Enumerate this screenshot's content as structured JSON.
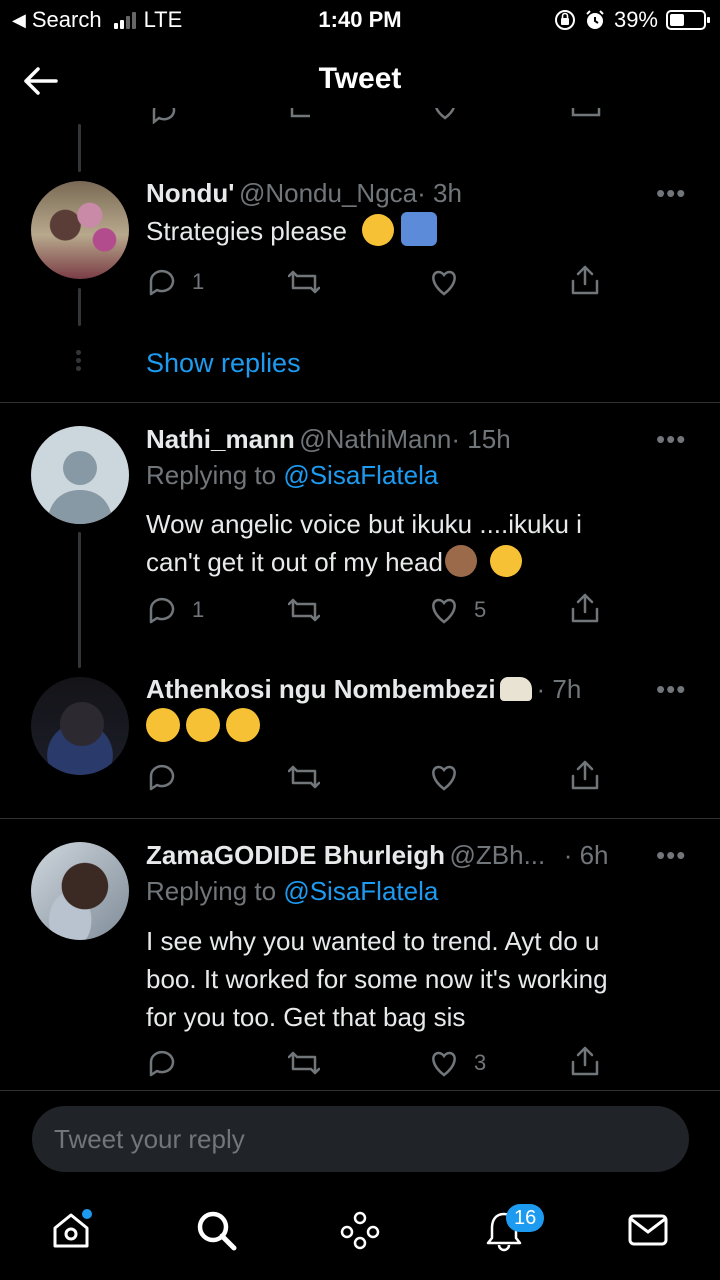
{
  "status_bar": {
    "carrier": "Search",
    "network": "LTE",
    "time": "1:40 PM",
    "battery": "39%"
  },
  "header": {
    "title": "Tweet"
  },
  "tweets": [
    {
      "name": "Nondu'",
      "handle": "@Nondu_Ngca",
      "time": "· 3h",
      "text": "Strategies please",
      "replies": "1",
      "retweets": "",
      "likes": ""
    },
    {
      "name": "Nathi_mann",
      "handle": "@NathiMann",
      "time": "· 15h",
      "replying_label": "Replying to",
      "replying_to": "@SisaFlatela",
      "text_line1": "Wow angelic voice  but ikuku ....ikuku i",
      "text_line2": "can't  get it out  of my head",
      "replies": "1",
      "likes": "5"
    },
    {
      "name": "Athenkosi ngu Nombembezi",
      "handle": "",
      "time": "· 7h",
      "text": "",
      "replies": "",
      "likes": ""
    },
    {
      "name": "ZamaGODIDE Bhurleigh",
      "handle": "@ZBh...",
      "time": "· 6h",
      "replying_label": "Replying to",
      "replying_to": "@SisaFlatela",
      "text_line1": "I see why you wanted to trend. Ayt do u",
      "text_line2": "boo. It worked for some now it's working",
      "text_line3": "for you too. Get that bag sis",
      "replies": "",
      "likes": "3"
    }
  ],
  "show_replies": "Show replies",
  "more_label": "•••",
  "reply_box": {
    "placeholder": "Tweet your reply"
  },
  "tabbar": {
    "notifications_badge": "16"
  },
  "colors": {
    "accent": "#1d9bf0",
    "muted": "#71767b",
    "background": "#000000"
  }
}
